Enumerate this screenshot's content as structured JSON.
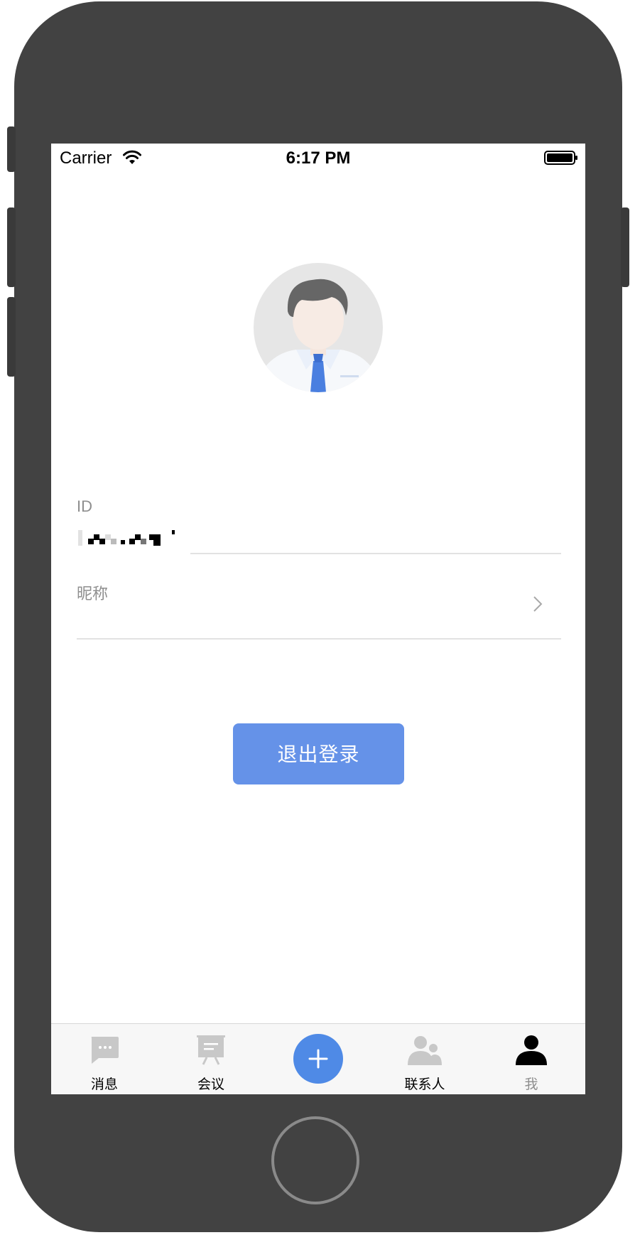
{
  "status_bar": {
    "carrier": "Carrier",
    "time": "6:17 PM"
  },
  "profile": {
    "id_label": "ID",
    "nickname_label": "昵称",
    "nickname_value": ""
  },
  "actions": {
    "logout_label": "退出登录"
  },
  "tabbar": {
    "items": [
      {
        "label": "消息",
        "icon": "message-icon"
      },
      {
        "label": "会议",
        "icon": "meeting-icon"
      },
      {
        "label": "",
        "icon": "plus-icon"
      },
      {
        "label": "联系人",
        "icon": "contacts-icon"
      },
      {
        "label": "我",
        "icon": "person-icon"
      }
    ]
  },
  "colors": {
    "accent": "#6592e8",
    "add_button": "#4f8ae6",
    "device_body": "#424242",
    "tab_inactive_icon": "#c8c8c8"
  }
}
